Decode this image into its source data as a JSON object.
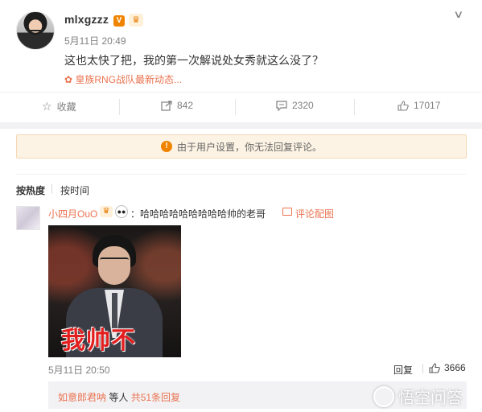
{
  "post": {
    "username": "mlxgzzz",
    "verified_badge": "V",
    "time": "5月11日 20:49",
    "text": "这也太快了把，我的第一次解说处女秀就这么没了？",
    "source": "皇族RNG战队最新动态...",
    "accent_color": "#eb7350"
  },
  "actions": {
    "favorite_label": "收藏",
    "repost_count": "842",
    "comment_count": "2320",
    "like_count": "17017"
  },
  "notice": {
    "icon": "!",
    "text": "由于用户设置，你无法回复评论。"
  },
  "sort": {
    "hot": "按热度",
    "time": "按时间"
  },
  "comment": {
    "username": "小四月OuO",
    "text": "：哈哈哈哈哈哈哈哈哈帅的老哥",
    "image_link": "评论配图",
    "meme_caption": "我帅不",
    "time": "5月11日 20:50",
    "reply_label": "回复",
    "likes": "3666",
    "sub_reply_user": "如意郎君呐",
    "sub_reply_mid": " 等人 ",
    "sub_reply_count": "共51条回复"
  },
  "watermark": {
    "text": "悟空问答"
  }
}
